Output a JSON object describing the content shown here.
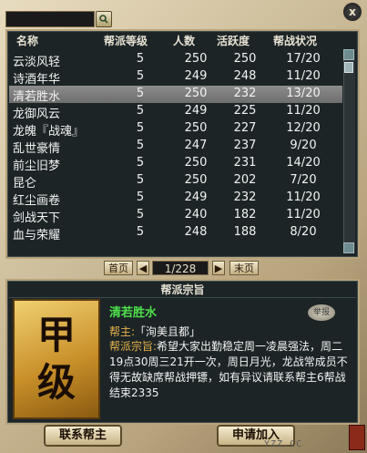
{
  "window": {
    "close_label": "x"
  },
  "search": {
    "value": "",
    "icon": "search-icon"
  },
  "table": {
    "columns": [
      "名称",
      "帮派等级",
      "人数",
      "活跃度",
      "帮战状况"
    ],
    "rows": [
      {
        "name": "云淡风轻",
        "level": "5",
        "members": "250",
        "activity": "250",
        "war": "17/20"
      },
      {
        "name": "诗酒年华",
        "level": "5",
        "members": "249",
        "activity": "248",
        "war": "11/20"
      },
      {
        "name": "清若胜水",
        "level": "5",
        "members": "250",
        "activity": "232",
        "war": "13/20"
      },
      {
        "name": "龙御风云",
        "level": "5",
        "members": "249",
        "activity": "225",
        "war": "11/20"
      },
      {
        "name": "龙魄『战魂』",
        "level": "5",
        "members": "250",
        "activity": "227",
        "war": "12/20"
      },
      {
        "name": "乱世豪情",
        "level": "5",
        "members": "247",
        "activity": "237",
        "war": "9/20"
      },
      {
        "name": "前尘旧梦",
        "level": "5",
        "members": "250",
        "activity": "231",
        "war": "14/20"
      },
      {
        "name": "昆仑",
        "level": "5",
        "members": "250",
        "activity": "202",
        "war": "7/20"
      },
      {
        "name": "红尘画卷",
        "level": "5",
        "members": "249",
        "activity": "232",
        "war": "11/20"
      },
      {
        "name": "剑战天下",
        "level": "5",
        "members": "240",
        "activity": "182",
        "war": "11/20"
      },
      {
        "name": "血与荣耀",
        "level": "5",
        "members": "248",
        "activity": "188",
        "war": "8/20"
      }
    ],
    "selected_index": 2
  },
  "pager": {
    "first": "首页",
    "prev": "◀",
    "page": "1/228",
    "next": "▶",
    "last": "末页"
  },
  "detail": {
    "title": "帮派宗旨",
    "badge_chars": [
      "甲",
      "级"
    ],
    "guild_name": "清若胜水",
    "report_label": "举报",
    "leader_label": "帮主:",
    "leader_value": "「洵美且都」",
    "motto_label": "帮派宗旨:",
    "motto_text": "希望大家出勤稳定周一凌晨强法，周二19点30周三21开一次，周日月光，龙战常成员不得无故缺席帮战押镖，如有异议请联系帮主6帮战结束2335"
  },
  "buttons": {
    "contact": "联系帮主",
    "apply": "申请加入"
  },
  "watermark": "YZZ.CC",
  "colors": {
    "selected_row": "#7a7a7a",
    "guild_name": "#4ee04a",
    "label": "#e6b34a"
  }
}
